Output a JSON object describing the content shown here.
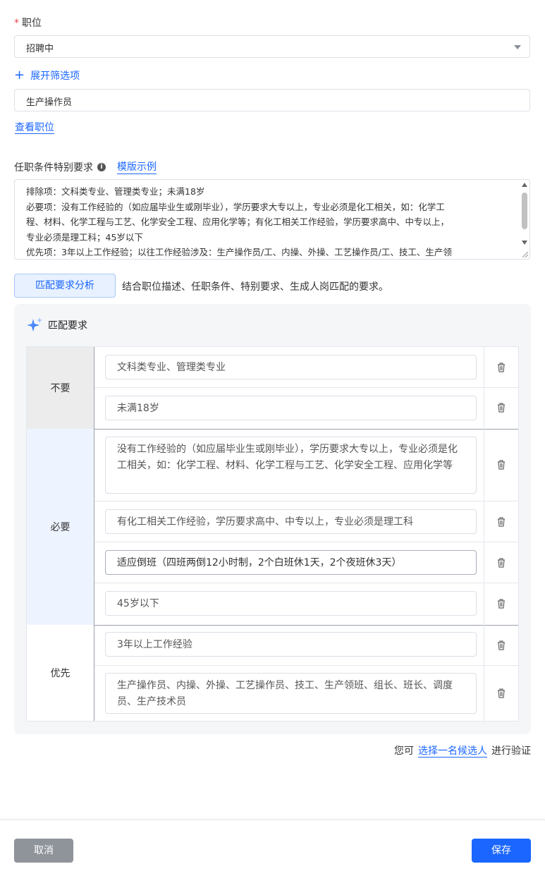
{
  "position": {
    "required_mark": "*",
    "label": "职位",
    "status_select": "招聘中",
    "expand_filters": "展开筛选项",
    "job_name": "生产操作员",
    "view_position": "查看职位"
  },
  "requirements": {
    "title": "任职条件特别要求",
    "template_link": "模版示例",
    "text_lines": [
      "排除项：文科类专业、管理类专业；未满18岁",
      "必要项：没有工作经验的（如应届毕业生或刚毕业），学历要求大专以上，专业必须是化工相关，如：化学工",
      "程、材料、化学工程与工艺、化学安全工程、应用化学等；有化工相关工作经验，学历要求高中、中专以上，",
      "专业必须是理工科；45岁以下",
      "优先项：3年以上工作经验；以往工作经验涉及：生产操作员/工、内操、外操、工艺操作员/工、技工、生产领"
    ]
  },
  "analyze": {
    "button": "匹配要求分析",
    "hint": "结合职位描述、任职条件、特别要求、生成人岗匹配的要求。"
  },
  "match": {
    "title": "匹配要求",
    "groups": [
      {
        "label": "不要",
        "items": [
          "文科类专业、管理类专业",
          "未满18岁"
        ]
      },
      {
        "label": "必要",
        "items": [
          "没有工作经验的（如应届毕业生或刚毕业），学历要求大专以上，专业必须是化工相关，如：化学工程、材料、化学工程与工艺、化学安全工程、应用化学等",
          "有化工相关工作经验，学历要求高中、中专以上，专业必须是理工科",
          "适应倒班（四班两倒12小时制，2个白班休1天，2个夜班休3天）",
          "45岁以下"
        ]
      },
      {
        "label": "优先",
        "items": [
          "3年以上工作经验",
          "生产操作员、内操、外操、工艺操作员、技工、生产领班、组长、班长、调度员、生产技术员"
        ]
      }
    ]
  },
  "verify": {
    "prefix": "您可",
    "link": "选择一名候选人",
    "suffix": "进行验证"
  },
  "footer": {
    "cancel": "取消",
    "save": "保存"
  },
  "colors": {
    "primary": "#1a66ff",
    "required": "#e5484d",
    "exclude_bg": "#ececec",
    "must_bg": "#eef4ff",
    "cancel_bg": "#8f939a"
  }
}
